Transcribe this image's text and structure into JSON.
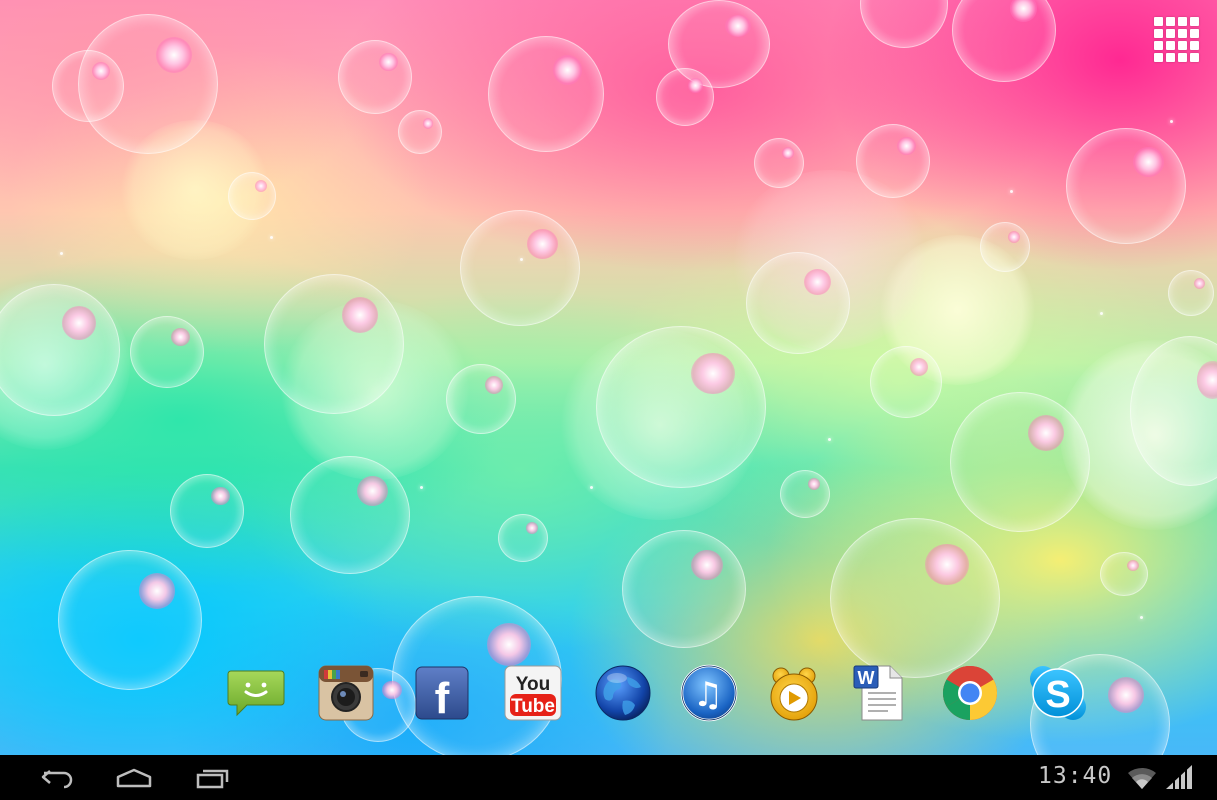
{
  "launcher": {
    "app_drawer_icon": "grid-icon"
  },
  "dock": {
    "apps": [
      {
        "name": "Messaging",
        "icon": "messaging-icon"
      },
      {
        "name": "Instagram",
        "icon": "instagram-icon"
      },
      {
        "name": "Facebook",
        "icon": "facebook-icon",
        "glyph": "f"
      },
      {
        "name": "YouTube",
        "icon": "youtube-icon",
        "glyph_top": "You",
        "glyph_bottom": "Tube"
      },
      {
        "name": "Browser",
        "icon": "globe-icon"
      },
      {
        "name": "Music",
        "icon": "music-icon",
        "glyph": "♫"
      },
      {
        "name": "GOM Player",
        "icon": "gom-player-icon"
      },
      {
        "name": "Word",
        "icon": "word-document-icon",
        "glyph": "W"
      },
      {
        "name": "Chrome",
        "icon": "chrome-icon"
      },
      {
        "name": "Skype",
        "icon": "skype-icon",
        "glyph": "S"
      }
    ]
  },
  "navbar": {
    "buttons": [
      "back-icon",
      "home-icon",
      "recent-apps-icon"
    ]
  },
  "status": {
    "time": "13:40",
    "wifi": "wifi-icon",
    "signal": "signal-icon"
  },
  "colors": {
    "navbar_bg": "#000000",
    "clock_text": "#c8c8c8",
    "facebook": "#3b5998",
    "youtube_red": "#e62117",
    "skype": "#00aff0",
    "messaging_green": "#8bc34a"
  }
}
